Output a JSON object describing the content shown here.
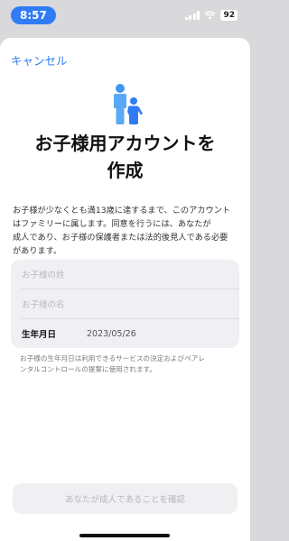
{
  "status_bar": {
    "time": "8:57",
    "battery": "92"
  },
  "navigation": {
    "cancel_label": "キャンセル"
  },
  "header": {
    "icon": "family-icon",
    "title_line1": "お子様用アカウントを",
    "title_line2": "作成"
  },
  "description": {
    "line1": "お子様が少なくとも満13歳に達するまで、このアカウント",
    "line2": "はファミリーに属します。同意を行うには、あなたが",
    "line3": "成人であり、お子様の保護者または法的後見人である必要",
    "line4": "があります。"
  },
  "form": {
    "last_name_placeholder": "お子様の姓",
    "first_name_placeholder": "お子様の名",
    "dob_label": "生年月日",
    "dob_value": "2023/05/26"
  },
  "note": {
    "line1": "お子様の生年月日は利用できるサービスの決定およびペアレ",
    "line2": "ンタルコントロールの提案に使用されます。"
  },
  "footer": {
    "confirm_label": "あなたが成人であることを確認"
  },
  "colors": {
    "accent": "#2f7cf6",
    "disabled_text": "#b6b6bc",
    "field_background": "#f0f0f4"
  }
}
